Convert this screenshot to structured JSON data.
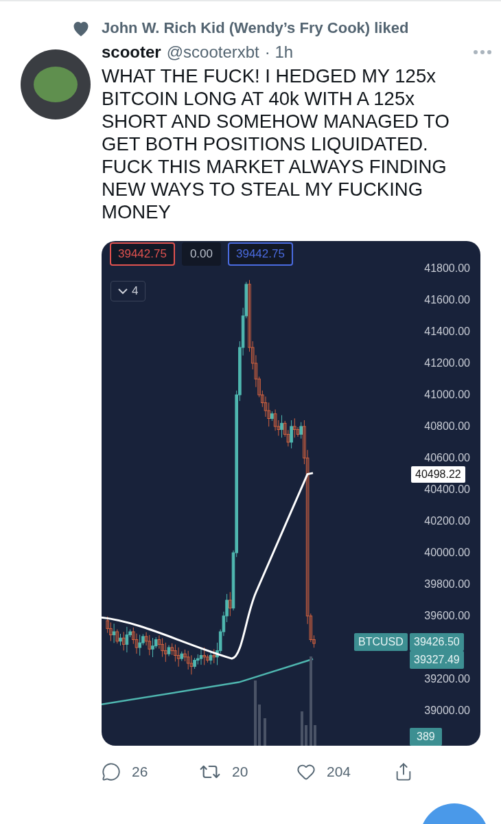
{
  "liked_by": {
    "text": "John W. Rich Kid (Wendy’s Fry Cook) liked"
  },
  "tweet": {
    "name": "scooter",
    "handle": "@scooterxbt",
    "time": "· 1h",
    "text": "WHAT THE FUCK! I HEDGED MY 125x BITCOIN LONG AT 40k WITH A 125x SHORT AND SOMEHOW MANAGED TO GET BOTH POSITIONS LIQUIDATED. FUCK THIS MARKET ALWAYS FINDING NEW WAYS TO STEAL MY FUCKING MONEY"
  },
  "chart": {
    "top_labels": [
      {
        "text": "39442.75",
        "kind": "bid"
      },
      {
        "text": "0.00",
        "kind": "spread"
      },
      {
        "text": "39442.75",
        "kind": "ask"
      }
    ],
    "interval": "4",
    "axis_labels": [
      "41800.00",
      "41600.00",
      "41400.00",
      "41200.00",
      "41000.00",
      "40800.00",
      "40600.00",
      "40400.00",
      "40200.00",
      "40000.00",
      "39800.00",
      "39600.00",
      "39200.00",
      "39000.00"
    ],
    "price_tag": "40498.22",
    "symbol": "BTCUSD",
    "last_price": "39426.50",
    "ma_price": "39327.49",
    "volume": "389"
  },
  "actions": [
    {
      "kind": "reply",
      "count": "26"
    },
    {
      "kind": "retweet",
      "count": "20"
    },
    {
      "kind": "like",
      "count": "204"
    },
    {
      "kind": "share"
    }
  ]
}
